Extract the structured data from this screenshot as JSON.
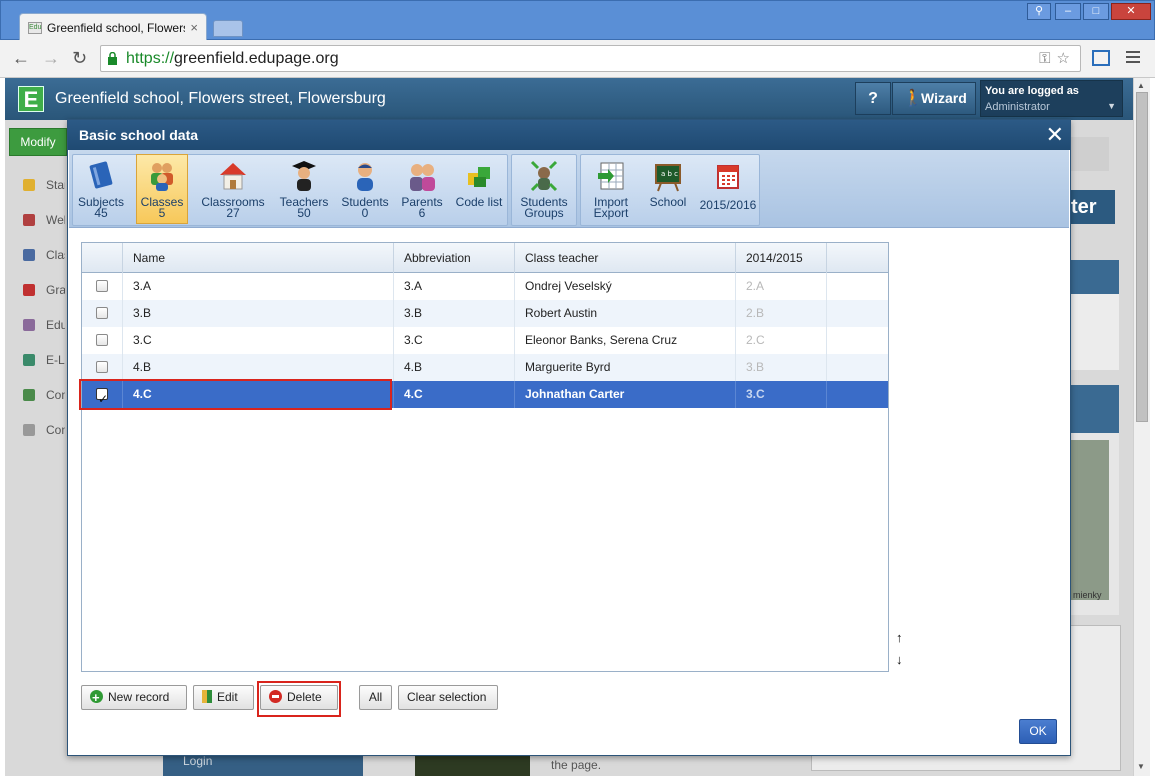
{
  "browser": {
    "tab_title": "Greenfield school, Flowers",
    "favicon_text": "Edu",
    "url_scheme": "https://",
    "url_host": "greenfield.edupage.org"
  },
  "header": {
    "school_name": "Greenfield school, Flowers street, Flowersburg",
    "help_label": "?",
    "wizard_label": "Wizard",
    "logged_as_label": "You are logged as",
    "user": "Administrator"
  },
  "background": {
    "modify_label": "Modify",
    "side_items": [
      "Star",
      "Wel",
      "Clas",
      "Gra",
      "Edu",
      "E-Le",
      "Con",
      "Con"
    ],
    "right_title": "ter",
    "map_label": "mienky",
    "login_label": "Login",
    "page_text": "the page."
  },
  "dialog": {
    "title": "Basic school data",
    "close_label": "✕",
    "ribbon": {
      "subjects": {
        "label": "Subjects",
        "count": "45"
      },
      "classes": {
        "label": "Classes",
        "count": "5"
      },
      "classrooms": {
        "label": "Classrooms",
        "count": "27"
      },
      "teachers": {
        "label": "Teachers",
        "count": "50"
      },
      "students": {
        "label": "Students",
        "count": "0"
      },
      "parents": {
        "label": "Parents",
        "count": "6"
      },
      "code_list": {
        "label": "Code list"
      },
      "students_groups": {
        "label": "Students",
        "label2": "Groups"
      },
      "import_export": {
        "label": "Import",
        "label2": "Export"
      },
      "school": {
        "label": "School"
      },
      "year": {
        "label": "2015/2016"
      }
    },
    "table": {
      "columns": [
        "Name",
        "Abbreviation",
        "Class teacher",
        "2014/2015"
      ],
      "rows": [
        {
          "name": "3.A",
          "abbr": "3.A",
          "teacher": "Ondrej Veselský",
          "prev": "2.A",
          "checked": false
        },
        {
          "name": "3.B",
          "abbr": "3.B",
          "teacher": "Robert Austin",
          "prev": "2.B",
          "checked": false
        },
        {
          "name": "3.C",
          "abbr": "3.C",
          "teacher": "Eleonor Banks, Serena Cruz",
          "prev": "2.C",
          "checked": false
        },
        {
          "name": "4.B",
          "abbr": "4.B",
          "teacher": "Marguerite Byrd",
          "prev": "3.B",
          "checked": false
        },
        {
          "name": "4.C",
          "abbr": "4.C",
          "teacher": "Johnathan Carter",
          "prev": "3.C",
          "checked": true
        }
      ]
    },
    "sort_up": "↑",
    "sort_down": "↓",
    "buttons": {
      "new_record": "New record",
      "edit": "Edit",
      "delete": "Delete",
      "all": "All",
      "clear_selection": "Clear selection",
      "ok": "OK"
    }
  },
  "colors": {
    "selection": "#3a6cc8",
    "highlight": "#d9241c",
    "header_bar": "#2c5a86",
    "ok_button": "#2d5fb5"
  }
}
